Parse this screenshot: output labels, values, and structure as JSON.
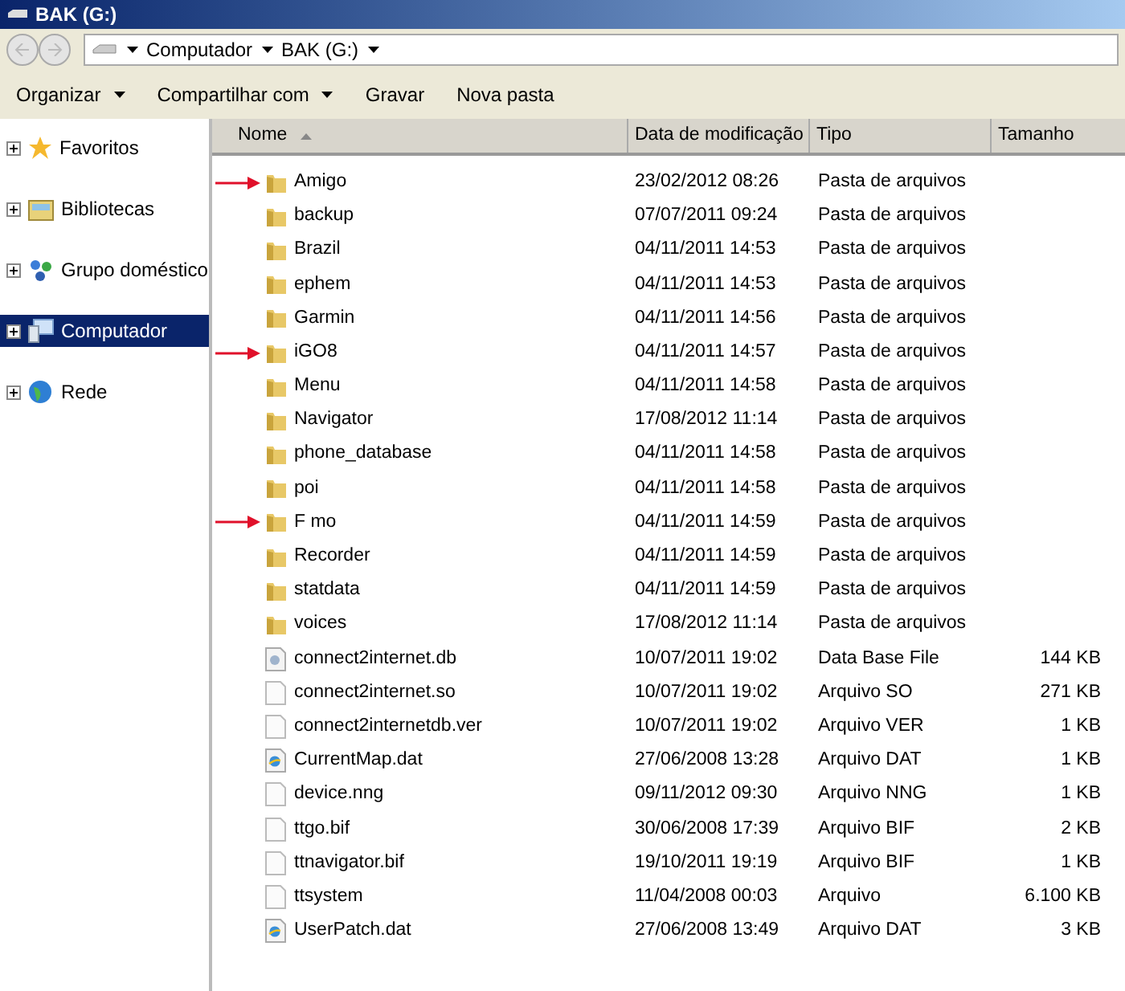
{
  "window": {
    "title": "BAK (G:)"
  },
  "address": {
    "segments": [
      "Computador",
      "BAK (G:)"
    ]
  },
  "toolbar": [
    {
      "label": "Organizar",
      "dropdown": true
    },
    {
      "label": "Compartilhar com",
      "dropdown": true
    },
    {
      "label": "Gravar",
      "dropdown": false
    },
    {
      "label": "Nova pasta",
      "dropdown": false
    }
  ],
  "sidebar": {
    "items": [
      {
        "label": "Favoritos",
        "kind": "star",
        "selected": false
      },
      {
        "label": "Bibliotecas",
        "kind": "library",
        "selected": false
      },
      {
        "label": "Grupo doméstico",
        "kind": "homegroup",
        "selected": false
      },
      {
        "label": "Computador",
        "kind": "computer",
        "selected": true
      },
      {
        "label": "Rede",
        "kind": "network",
        "selected": false
      }
    ]
  },
  "table": {
    "columns": [
      "Nome",
      "Data de modificação",
      "Tipo",
      "Tamanho"
    ],
    "rows": [
      {
        "name": "Amigo",
        "date": "23/02/2012 08:26",
        "type": "Pasta de arquivos",
        "kind": "folder",
        "marked": true
      },
      {
        "name": "backup",
        "date": "07/07/2011 09:24",
        "type": "Pasta de arquivos",
        "kind": "folder",
        "marked": false
      },
      {
        "name": "Brazil",
        "date": "04/11/2011 14:53",
        "type": "Pasta de arquivos",
        "kind": "folder",
        "marked": false
      },
      {
        "name": "ephem",
        "date": "04/11/2011 14:53",
        "type": "Pasta de arquivos",
        "kind": "folder",
        "marked": false
      },
      {
        "name": "Garmin",
        "date": "04/11/2011 14:56",
        "type": "Pasta de arquivos",
        "kind": "folder",
        "marked": false
      },
      {
        "name": "iGO8",
        "date": "04/11/2011 14:57",
        "type": "Pasta de arquivos",
        "kind": "folder",
        "marked": true
      },
      {
        "name": "Menu",
        "date": "04/11/2011 14:58",
        "type": "Pasta de arquivos",
        "kind": "folder",
        "marked": false
      },
      {
        "name": "Navigator",
        "date": "17/08/2012 11:14",
        "type": "Pasta de arquivos",
        "kind": "folder",
        "marked": false
      },
      {
        "name": "phone_database",
        "date": "04/11/2011 14:58",
        "type": "Pasta de arquivos",
        "kind": "folder",
        "marked": false
      },
      {
        "name": "poi",
        "date": "04/11/2011 14:58",
        "type": "Pasta de arquivos",
        "kind": "folder",
        "marked": false
      },
      {
        "name": "F mo",
        "date": "04/11/2011 14:59",
        "type": "Pasta de arquivos",
        "kind": "folder",
        "marked": true
      },
      {
        "name": "Recorder",
        "date": "04/11/2011 14:59",
        "type": "Pasta de arquivos",
        "kind": "folder",
        "marked": false
      },
      {
        "name": "statdata",
        "date": "04/11/2011 14:59",
        "type": "Pasta de arquivos",
        "kind": "folder",
        "marked": false
      },
      {
        "name": "voices",
        "date": "17/08/2012 11:14",
        "type": "Pasta de arquivos",
        "kind": "folder",
        "marked": false
      },
      {
        "name": "connect2internet.db",
        "date": "10/07/2011 19:02",
        "type": "Data Base File",
        "size": "144 KB",
        "kind": "db",
        "marked": false
      },
      {
        "name": "connect2internet.so",
        "date": "10/07/2011 19:02",
        "type": "Arquivo SO",
        "size": "271 KB",
        "kind": "file",
        "marked": false
      },
      {
        "name": "connect2internetdb.ver",
        "date": "10/07/2011 19:02",
        "type": "Arquivo VER",
        "size": "1 KB",
        "kind": "file",
        "marked": false
      },
      {
        "name": "CurrentMap.dat",
        "date": "27/06/2008 13:28",
        "type": "Arquivo DAT",
        "size": "1 KB",
        "kind": "dat",
        "marked": false
      },
      {
        "name": "device.nng",
        "date": "09/11/2012 09:30",
        "type": "Arquivo NNG",
        "size": "1 KB",
        "kind": "file",
        "marked": false
      },
      {
        "name": "ttgo.bif",
        "date": "30/06/2008 17:39",
        "type": "Arquivo BIF",
        "size": "2 KB",
        "kind": "file",
        "marked": false
      },
      {
        "name": "ttnavigator.bif",
        "date": "19/10/2011 19:19",
        "type": "Arquivo BIF",
        "size": "1 KB",
        "kind": "file",
        "marked": false
      },
      {
        "name": "ttsystem",
        "date": "11/04/2008 00:03",
        "type": "Arquivo",
        "size": "6.100 KB",
        "kind": "file",
        "marked": false
      },
      {
        "name": "UserPatch.dat",
        "date": "27/06/2008 13:49",
        "type": "Arquivo DAT",
        "size": "3 KB",
        "kind": "dat",
        "marked": false
      }
    ]
  }
}
